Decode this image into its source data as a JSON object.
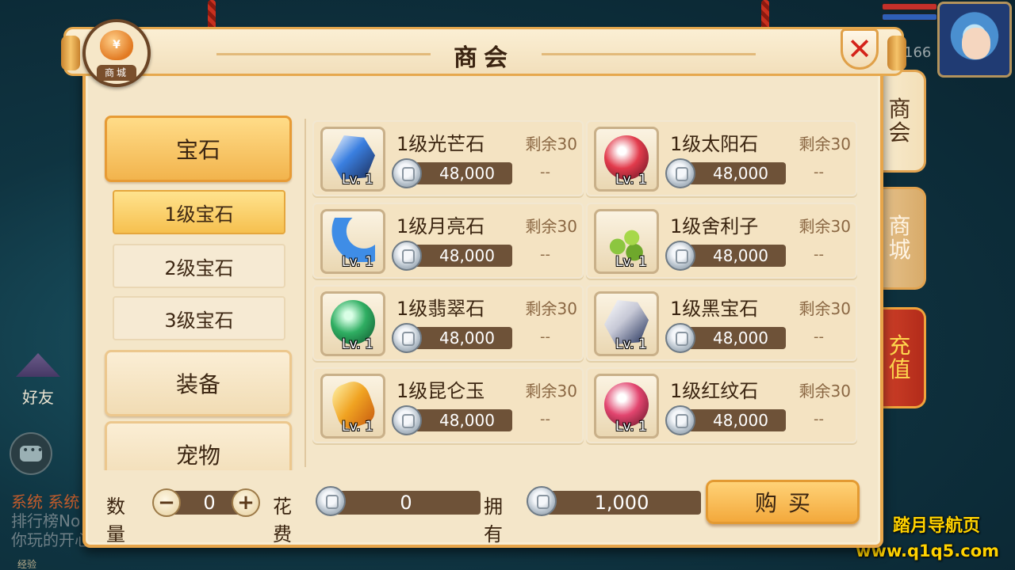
{
  "hud": {
    "level": "166",
    "friends_label": "好友",
    "chat_lines": [
      "系统 系统",
      "排行榜No",
      "你玩的开心"
    ],
    "exp_label": "经验"
  },
  "watermark": {
    "line1": "踏月导航页",
    "line2": "www.q1q5.com"
  },
  "shop": {
    "title": "商会",
    "logo_label": "商城",
    "logo_symbol": "¥",
    "close_icon": "✕",
    "side_tabs": [
      {
        "label": "商会",
        "active": true
      },
      {
        "label": "商城",
        "active": false
      },
      {
        "label": "充值",
        "active": false
      }
    ],
    "categories": [
      {
        "label": "宝石",
        "active": true
      },
      {
        "label": "装备",
        "active": false
      },
      {
        "label": "宠物",
        "active": false
      }
    ],
    "subcategories": [
      {
        "label": "1级宝石",
        "active": true
      },
      {
        "label": "2级宝石",
        "active": false
      },
      {
        "label": "3级宝石",
        "active": false
      }
    ],
    "items": [
      {
        "name": "1级光芒石",
        "remain": "剩余30",
        "price": "48,000",
        "level": "Lv. 1",
        "dash": "--",
        "icon": "blue-crystal-icon",
        "color": "#3a7fe0"
      },
      {
        "name": "1级太阳石",
        "remain": "剩余30",
        "price": "48,000",
        "level": "Lv. 1",
        "dash": "--",
        "icon": "red-swirl-gem-icon",
        "color": "#e23b4c"
      },
      {
        "name": "1级月亮石",
        "remain": "剩余30",
        "price": "48,000",
        "level": "Lv. 1",
        "dash": "--",
        "icon": "blue-moon-gem-icon",
        "color": "#3f8de6"
      },
      {
        "name": "1级舍利子",
        "remain": "剩余30",
        "price": "48,000",
        "level": "Lv. 1",
        "dash": "--",
        "icon": "green-beads-icon",
        "color": "#8cc63f"
      },
      {
        "name": "1级翡翠石",
        "remain": "剩余30",
        "price": "48,000",
        "level": "Lv. 1",
        "dash": "--",
        "icon": "jade-orb-icon",
        "color": "#2fae62"
      },
      {
        "name": "1级黑宝石",
        "remain": "剩余30",
        "price": "48,000",
        "level": "Lv. 1",
        "dash": "--",
        "icon": "black-diamond-icon",
        "color": "#c6c8d6"
      },
      {
        "name": "1级昆仑玉",
        "remain": "剩余30",
        "price": "48,000",
        "level": "Lv. 1",
        "dash": "--",
        "icon": "amber-jade-icon",
        "color": "#f0a322"
      },
      {
        "name": "1级红纹石",
        "remain": "剩余30",
        "price": "48,000",
        "level": "Lv. 1",
        "dash": "--",
        "icon": "pink-swirl-gem-icon",
        "color": "#e2456f"
      }
    ],
    "bottom": {
      "quantity_label": "数量",
      "quantity": "0",
      "minus": "−",
      "plus": "+",
      "cost_label": "花费",
      "cost": "0",
      "owned_label": "拥有",
      "owned": "1,000",
      "buy_label": "购买"
    }
  }
}
